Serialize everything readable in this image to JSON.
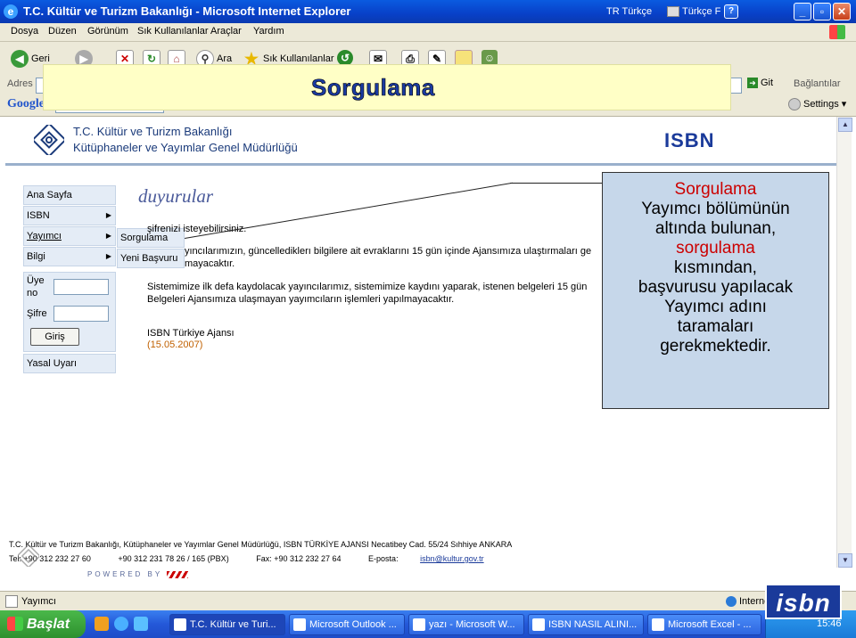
{
  "window": {
    "title": "T.C. Kültür ve Turizm Bakanlığı - Microsoft Internet Explorer",
    "lang1": "TR Türkçe",
    "lang2": "Türkçe F"
  },
  "menu": [
    "Dosya",
    "Düzen",
    "Görünüm",
    "Sık Kullanılanlar",
    "Araçlar",
    "Yardım"
  ],
  "toolbar": {
    "back": "Geri",
    "search": "Ara",
    "favorites": "Sık Kullanılanlar"
  },
  "address": {
    "label": "Adres",
    "go": "Git",
    "links": "Bağlantılar"
  },
  "google": {
    "logo": "Google",
    "settings": "Settings"
  },
  "slide": {
    "title": "Sorgulama"
  },
  "site": {
    "name1": "T.C. Kültür ve Turizm Bakanlığı",
    "name2": "Kütüphaneler ve Yayımlar Genel Müdürlüğü",
    "isbn": "ISBN"
  },
  "nav": {
    "items": [
      "Ana Sayfa",
      "ISBN",
      "Yayımcı",
      "Bilgi"
    ],
    "submenu": [
      "Sorgulama",
      "Yeni Başvuru"
    ],
    "member_label": "Üye",
    "member_label2": "no",
    "password_label": "Şifre",
    "login_button": "Giriş",
    "legal": "Yasal Uyarı"
  },
  "main": {
    "heading": "duyurular",
    "line1": "şifrenizi isteyebilirsiniz.",
    "line2": "yıncılarımızın, güncellediklerı bilgilere ait evraklarını 15 gün içinde Ajansımıza ulaştırmaları ge",
    "line3": "mayacaktır.",
    "line4": "Sistemimize ilk defa kaydolacak yayıncılarımız, sistemimize kaydını yaparak, istenen belgeleri 15 gün",
    "line5": "Belgeleri Ajansımıza ulaşmayan yayımcıların işlemleri yapılmayacaktır.",
    "sign1": "ISBN Türkiye Ajansı",
    "sign2": "(15.05.2007)"
  },
  "callout": {
    "lines": [
      {
        "text": "Sorgulama",
        "red": true
      },
      {
        "text": "Yayımcı bölümünün",
        "red": false
      },
      {
        "text": "altında bulunan,",
        "red": false
      },
      {
        "text": "sorgulama",
        "red": true
      },
      {
        "text": "kısmından,",
        "red": false
      },
      {
        "text": "başvurusu yapılacak",
        "red": false
      },
      {
        "text": "Yayımcı adını",
        "red": false
      },
      {
        "text": "taramaları",
        "red": false
      },
      {
        "text": "gerekmektedir.",
        "red": false
      }
    ]
  },
  "footer": {
    "line1": "T.C. Kültür ve Turizm Bakanlığı, Kütüphaneler ve Yayımlar Genel Müdürlüğü, ISBN TÜRKİYE AJANSI Necatibey Cad. 55/24 Sıhhiye ANKARA",
    "tel": "Tel: +90 312 232 27 60",
    "pbx": "+90 312 231 78 26 / 165 (PBX)",
    "fax": "Fax:   +90 312 232 27 64",
    "email_label": "E-posta:",
    "email": "isbn@kultur.gov.tr",
    "powered": "POWERED BY"
  },
  "status": {
    "text": "Yayımcı",
    "zone": "Internet"
  },
  "taskbar": {
    "start": "Başlat",
    "tasks": [
      "T.C. Kültür ve Turi...",
      "Microsoft Outlook ...",
      "yazı - Microsoft W...",
      "ISBN NASIL ALINI...",
      "Microsoft Excel - ..."
    ],
    "clock": "15:46",
    "logo": "isbn"
  }
}
